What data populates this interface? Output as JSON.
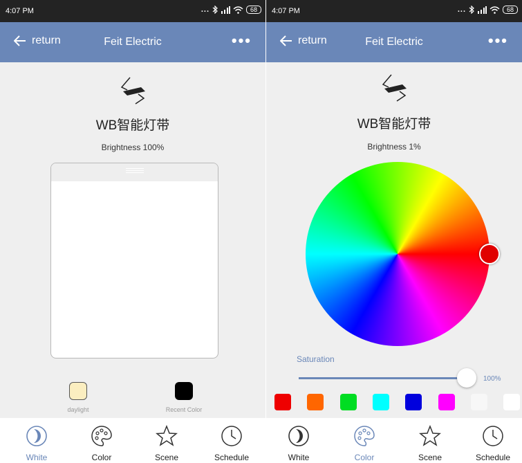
{
  "statusbar": {
    "time": "4:07 PM",
    "battery": "68",
    "icons_dots": "..."
  },
  "appbar": {
    "back_label": "return",
    "title": "Feit Electric",
    "more": "•••"
  },
  "device": {
    "name": "WB智能灯带"
  },
  "left_screen": {
    "brightness": "Brightness 100%",
    "swatches": [
      {
        "label": "daylight",
        "color": "#fbeec0"
      },
      {
        "label": "Recent Color",
        "color": "#000000"
      }
    ],
    "active_tab": "White"
  },
  "right_screen": {
    "brightness": "Brightness 1%",
    "saturation_label": "Saturation",
    "saturation_value": "100%",
    "saturation_level": 100,
    "selected_color": "#e00000",
    "preset_colors": [
      "#ee0000",
      "#ff6600",
      "#00dd22",
      "#00ffff",
      "#0000dd",
      "#ff00ff",
      "#f7f7f7",
      "#ffffff"
    ],
    "active_tab": "Color"
  },
  "tabs": [
    {
      "label": "White",
      "icon": "moon-icon"
    },
    {
      "label": "Color",
      "icon": "palette-icon"
    },
    {
      "label": "Scene",
      "icon": "star-icon"
    },
    {
      "label": "Schedule",
      "icon": "clock-icon"
    }
  ],
  "colors": {
    "header": "#6a87b8",
    "statusbar": "#232323",
    "accent": "#6a87b8",
    "background": "#efefef"
  }
}
